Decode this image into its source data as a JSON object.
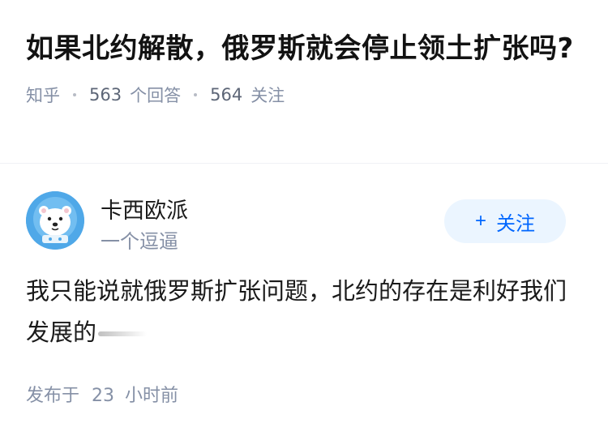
{
  "question": {
    "title": "如果北约解散，俄罗斯就会停止领土扩张吗?",
    "source": "知乎",
    "answer_count": "563",
    "answer_label": "个回答",
    "follow_count": "564",
    "follow_label": "关注"
  },
  "answer": {
    "author_name": "卡西欧派",
    "author_bio": "一个逗逼",
    "follow_button_plus": "+",
    "follow_button_label": "关注",
    "content": "我只能说就俄罗斯扩张问题，北约的存在是利好我们发展的",
    "published_prefix": "发布于",
    "published_value": "23",
    "published_suffix": "小时前"
  },
  "colors": {
    "accent": "#0066ff",
    "follow_bg": "#ebf5ff",
    "meta_gray": "#8590a6",
    "avatar_blue": "#4fa8e8"
  },
  "icons": {
    "avatar": "polar-bear-astronaut-avatar"
  }
}
